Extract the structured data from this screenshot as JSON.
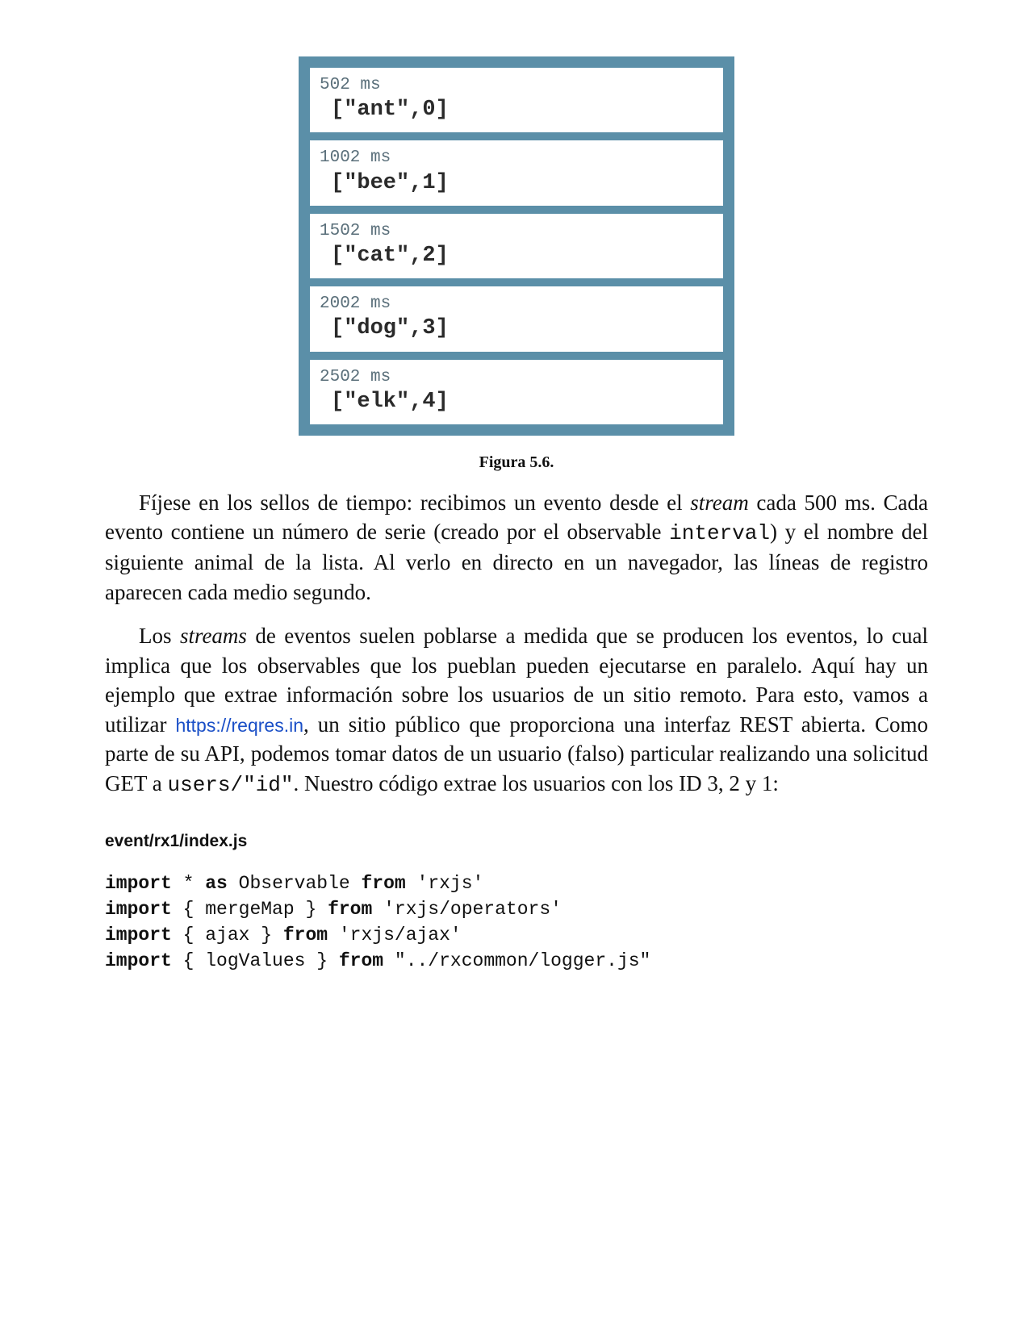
{
  "figure": {
    "items": [
      {
        "time": "502 ms",
        "value": "[\"ant\",0]"
      },
      {
        "time": "1002 ms",
        "value": "[\"bee\",1]"
      },
      {
        "time": "1502 ms",
        "value": "[\"cat\",2]"
      },
      {
        "time": "2002 ms",
        "value": "[\"dog\",3]"
      },
      {
        "time": "2502 ms",
        "value": "[\"elk\",4]"
      }
    ],
    "caption": "Figura 5.6."
  },
  "para1": {
    "t0": "Fíjese en los sellos de tiempo: recibimos un evento desde el ",
    "em1": "stream",
    "t1": " cada 500 ms. Cada evento contiene un número de serie (creado por el observable ",
    "code1": "interval",
    "t2": ") y el nombre del siguiente animal de la lista. Al verlo en directo en un navegador, las líneas de registro aparecen cada medio segundo."
  },
  "para2": {
    "t0": "Los ",
    "em1": "streams",
    "t1": " de eventos suelen poblarse a medida que se producen los eventos, lo cual implica que los observables que los pueblan pueden ejecutarse en paralelo. Aquí hay un ejemplo que extrae información sobre los usuarios de un sitio remoto. Para esto, vamos a utilizar ",
    "link": "https://reqres.in",
    "t2": ", un sitio público que proporciona una interfaz REST abierta. Como parte de su API, podemos tomar datos de un usuario (falso) particular realizando una solicitud GET a ",
    "code1": "users/\"id\"",
    "t3": ". Nuestro código extrae los usuarios con los ID 3, 2 y 1:"
  },
  "codefile": "event/rx1/index.js",
  "code": {
    "kw1": "import",
    "l1a": " * ",
    "kw2": "as",
    "l1b": " Observable ",
    "kw3": "from",
    "l1c": " 'rxjs'",
    "kw4": "import",
    "l2a": " { mergeMap } ",
    "kw5": "from",
    "l2b": " 'rxjs/operators'",
    "kw6": "import",
    "l3a": " { ajax } ",
    "kw7": "from",
    "l3b": " 'rxjs/ajax'",
    "kw8": "import",
    "l4a": " { logValues } ",
    "kw9": "from",
    "l4b": " \"../rxcommon/logger.js\""
  }
}
